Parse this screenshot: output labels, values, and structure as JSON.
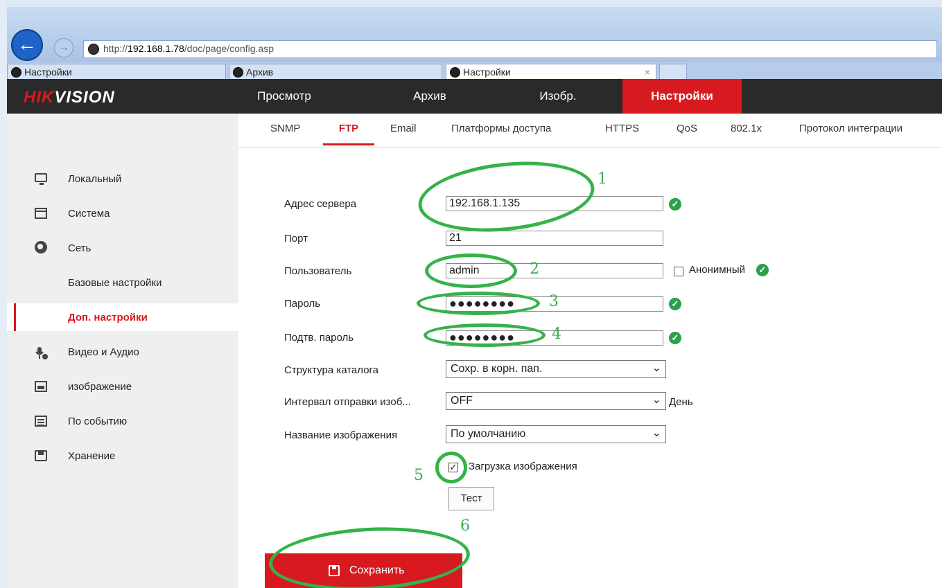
{
  "browser": {
    "url_prefix": "http://",
    "url_host": "192.168.1.78",
    "url_path": "/doc/page/config.asp",
    "back_icon": "←",
    "forward_icon": "→",
    "tabs": [
      {
        "label": "Настройки"
      },
      {
        "label": "Архив"
      },
      {
        "label": "Настройки",
        "close": "×"
      }
    ]
  },
  "header": {
    "logo_red": "HIK",
    "logo_white": "VISION",
    "nav": [
      "Просмотр",
      "Архив",
      "Изобр.",
      "Настройки"
    ]
  },
  "sidebar": {
    "items": [
      {
        "label": "Локальный",
        "icon": "monitor-icon"
      },
      {
        "label": "Система",
        "icon": "window-icon"
      },
      {
        "label": "Сеть",
        "icon": "globe-icon"
      },
      {
        "label": "Базовые настройки"
      },
      {
        "label": "Доп. настройки"
      },
      {
        "label": "Видео и Аудио",
        "icon": "mic-camera-icon"
      },
      {
        "label": "изображение",
        "icon": "image-icon"
      },
      {
        "label": "По событию",
        "icon": "calendar-icon"
      },
      {
        "label": "Хранение",
        "icon": "save-icon"
      }
    ]
  },
  "subtabs": [
    "SNMP",
    "FTP",
    "Email",
    "Платформы доступа",
    "HTTPS",
    "QoS",
    "802.1x",
    "Протокол интеграции"
  ],
  "form": {
    "server_label": "Адрес сервера",
    "server_value": "192.168.1.135",
    "port_label": "Порт",
    "port_value": "21",
    "user_label": "Пользователь",
    "user_value": "admin",
    "anon_label": "Анонимный",
    "password_label": "Пароль",
    "password_value": "●●●●●●●●",
    "confirm_label": "Подтв. пароль",
    "confirm_value": "●●●●●●●●",
    "dir_label": "Структура каталога",
    "dir_value": "Сохр. в корн. пап.",
    "interval_label": "Интервал отправки изоб...",
    "interval_value": "OFF",
    "interval_unit": "День",
    "name_label": "Название изображения",
    "name_value": "По умолчанию",
    "upload_label": "Загрузка изображения",
    "upload_checked": "✓",
    "test_label": "Тест",
    "save_label": "Сохранить",
    "ok_mark": "✓",
    "chevron": "❯"
  },
  "annotations": [
    "1",
    "2",
    "3",
    "4",
    "5",
    "6"
  ],
  "colors": {
    "accent": "#d71920",
    "annotation": "#36b24a",
    "ok": "#2aa14b",
    "header_bg": "#2a2a2a"
  }
}
